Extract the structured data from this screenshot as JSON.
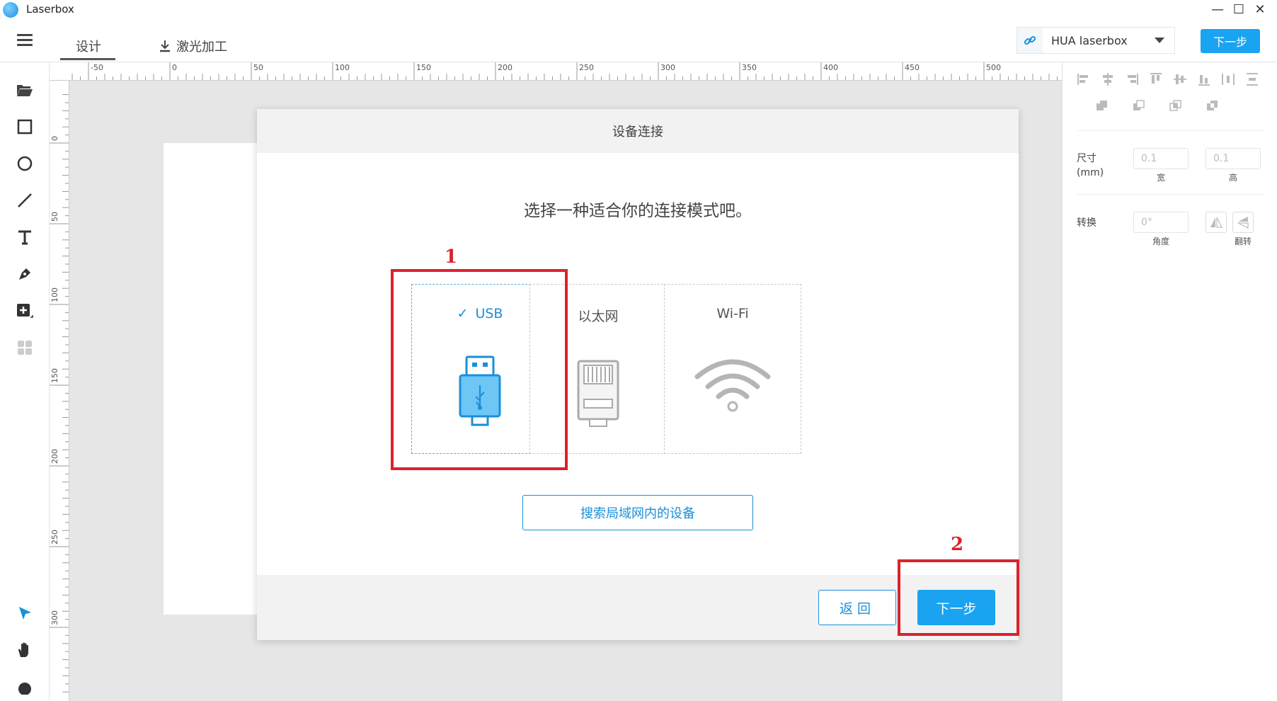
{
  "window": {
    "title": "Laserbox",
    "minimize": "—",
    "maximize": "☐",
    "close": "✕"
  },
  "header": {
    "tabs": [
      {
        "label": "设计"
      },
      {
        "label": "激光加工"
      }
    ],
    "device": {
      "name": "HUA laserbox"
    },
    "next_label": "下一步"
  },
  "ruler": {
    "top_labels": [
      "-50",
      "0",
      "50",
      "100",
      "150",
      "200",
      "250",
      "300",
      "350",
      "400",
      "450",
      "500"
    ],
    "left_labels": [
      "0",
      "50",
      "100",
      "150",
      "200",
      "250",
      "300"
    ]
  },
  "right_panel": {
    "size_label": "尺寸",
    "size_unit": "(mm)",
    "width_value": "0.1",
    "height_value": "0.1",
    "width_label": "宽",
    "height_label": "高",
    "transform_label": "转换",
    "angle_value": "0°",
    "angle_label": "角度",
    "flip_label": "翻转"
  },
  "dialog": {
    "title": "设备连接",
    "prompt": "选择一种适合你的连接模式吧。",
    "options": [
      {
        "label": "USB",
        "selected": true,
        "icon": "usb-icon"
      },
      {
        "label": "以太网",
        "selected": false,
        "icon": "ethernet-icon"
      },
      {
        "label": "Wi-Fi",
        "selected": false,
        "icon": "wifi-icon"
      }
    ],
    "search_label": "搜索局域网内的设备",
    "back_label": "返回",
    "next_label": "下一步"
  },
  "annotations": [
    "1",
    "2"
  ],
  "colors": {
    "accent": "#1aa3f0",
    "annotation": "#d9232b",
    "canvas": "#e6e6e6"
  }
}
